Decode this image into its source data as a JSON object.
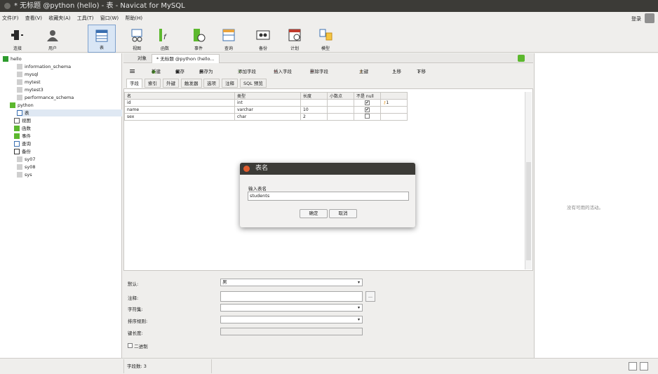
{
  "window": {
    "title": "* 无标题 @python (hello) - 表 - Navicat for MySQL"
  },
  "menu": [
    "文件(F)",
    "查看(V)",
    "收藏夹(A)",
    "工具(T)",
    "窗口(W)",
    "帮助(H)"
  ],
  "login_label": "登录",
  "toolbar": [
    {
      "label": "连接",
      "icon": "connection-icon"
    },
    {
      "label": "用户",
      "icon": "user-icon"
    },
    {
      "label": "表",
      "icon": "table-icon"
    },
    {
      "label": "视图",
      "icon": "view-icon"
    },
    {
      "label": "函数",
      "icon": "function-icon"
    },
    {
      "label": "事件",
      "icon": "event-icon"
    },
    {
      "label": "查询",
      "icon": "query-icon"
    },
    {
      "label": "备份",
      "icon": "backup-icon"
    },
    {
      "label": "计划",
      "icon": "schedule-icon"
    },
    {
      "label": "模型",
      "icon": "model-icon"
    }
  ],
  "tree": [
    "hello",
    "information_schema",
    "mysql",
    "mytest",
    "mytest3",
    "performance_schema",
    "python",
    "表",
    "视图",
    "函数",
    "事件",
    "查询",
    "备份",
    "sy07",
    "sy08",
    "sys"
  ],
  "tabs": {
    "objects": "对象",
    "design": "* 无标题 @python (hello..."
  },
  "editbar": {
    "new": "新建",
    "save": "保存",
    "save_as": "另存为",
    "add_field": "添加字段",
    "insert_field": "插入字段",
    "delete_field": "删除字段",
    "primary_key": "主键",
    "move_up": "上移",
    "move_down": "下移"
  },
  "subtabs": [
    "字段",
    "索引",
    "外键",
    "触发器",
    "选项",
    "注释",
    "SQL 预览"
  ],
  "columns": [
    "名",
    "类型",
    "长度",
    "小数点",
    "不是 null",
    ""
  ],
  "rows": [
    {
      "name": "id",
      "type": "int",
      "length": "",
      "decimals": "",
      "not_null": "✔",
      "key": "1"
    },
    {
      "name": "name",
      "type": "varchar",
      "length": "10",
      "decimals": "",
      "not_null": "✔",
      "key": ""
    },
    {
      "name": "sex",
      "type": "char",
      "length": "2",
      "decimals": "",
      "not_null": "",
      "key": ""
    }
  ],
  "props": {
    "default_label": "默认:",
    "default_value": "男",
    "comment_label": "注释:",
    "charset_label": "字符集:",
    "collation_label": "排序规则:",
    "key_length_label": "键长度:",
    "binary_label": "二进制"
  },
  "right_pane": "没有可用的活动。",
  "status": "字段数: 3",
  "dialog": {
    "title": "表名",
    "prompt": "输入表名",
    "value": "students",
    "ok": "确定",
    "cancel": "取消"
  },
  "colors": {
    "titlebar": "#3c3b37",
    "accent": "#7ea1cc",
    "close": "#e05c2e"
  }
}
